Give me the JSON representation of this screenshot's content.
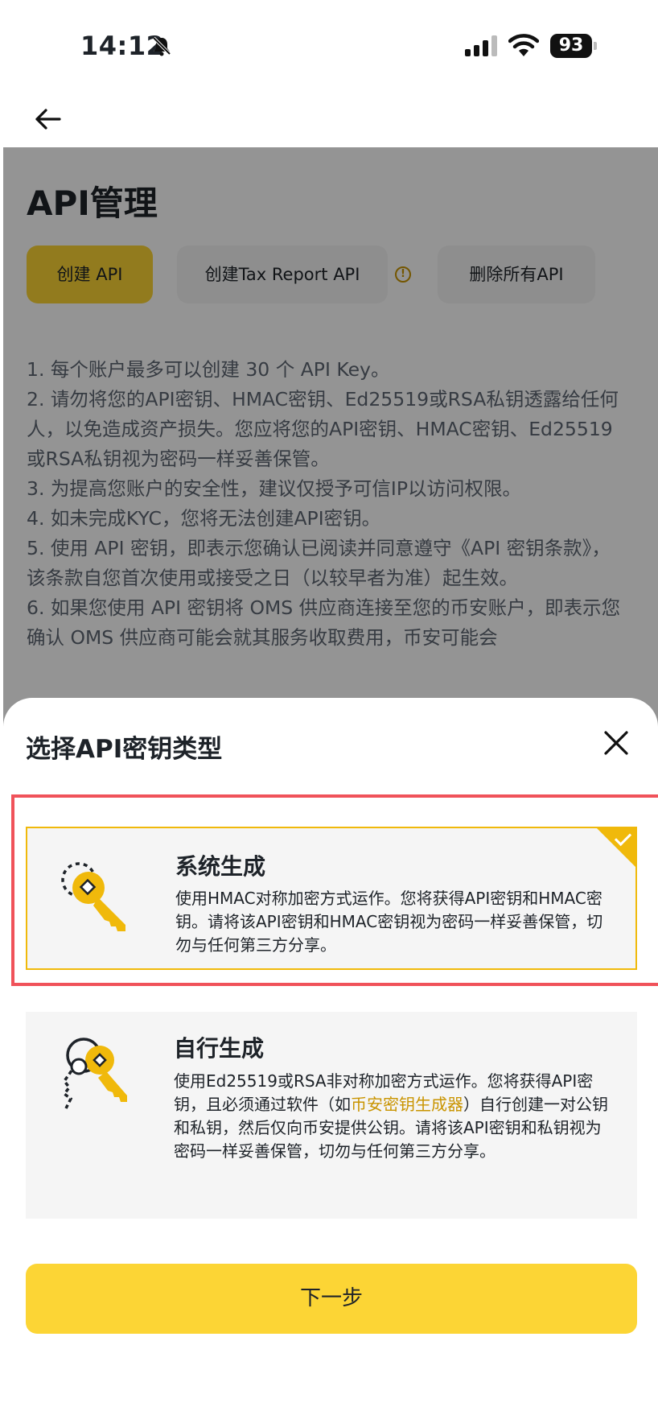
{
  "status_bar": {
    "time": "14:12",
    "battery": "93"
  },
  "page": {
    "title": "API管理",
    "buttons": {
      "create_api": "创建 API",
      "create_tax_api": "创建Tax Report API",
      "delete_all": "删除所有API"
    },
    "info_icon": "!",
    "notes": [
      "1. 每个账户最多可以创建 30 个 API Key。",
      "2. 请勿将您的API密钥、HMAC密钥、Ed25519或RSA私钥透露给任何人，以免造成资产损失。您应将您的API密钥、HMAC密钥、Ed25519或RSA私钥视为密码一样妥善保管。",
      "3. 为提高您账户的安全性，建议仅授予可信IP以访问权限。",
      "4. 如未完成KYC，您将无法创建API密钥。",
      "5. 使用 API 密钥，即表示您确认已阅读并同意遵守《API 密钥条款》，该条款自您首次使用或接受之日（以较早者为准）起生效。",
      "6. 如果您使用 API 密钥将 OMS 供应商连接至您的币安账户，即表示您确认 OMS 供应商可能会就其服务收取费用，币安可能会"
    ]
  },
  "sheet": {
    "title": "选择API密钥类型",
    "options": [
      {
        "heading": "系统生成",
        "description": "使用HMAC对称加密方式运作。您将获得API密钥和HMAC密钥。请将该API密钥和HMAC密钥视为密码一样妥善保管，切勿与任何第三方分享。",
        "selected": true,
        "icon": "key-icon"
      },
      {
        "heading": "自行生成",
        "desc_before": "使用Ed25519或RSA非对称加密方式运作。您将获得API密钥，且必须通过软件（如",
        "desc_link": "币安密钥生成器",
        "desc_after": "）自行创建一对公钥和私钥，然后仅向币安提供公钥。请将该API密钥和私钥视为密码一样妥善保管，切勿与任何第三方分享。",
        "selected": false,
        "icon": "keys-icon"
      }
    ],
    "next_label": "下一步"
  },
  "colors": {
    "brand_yellow": "#fcd535",
    "accent_gold": "#c99400",
    "highlight_red": "#f0525a"
  }
}
